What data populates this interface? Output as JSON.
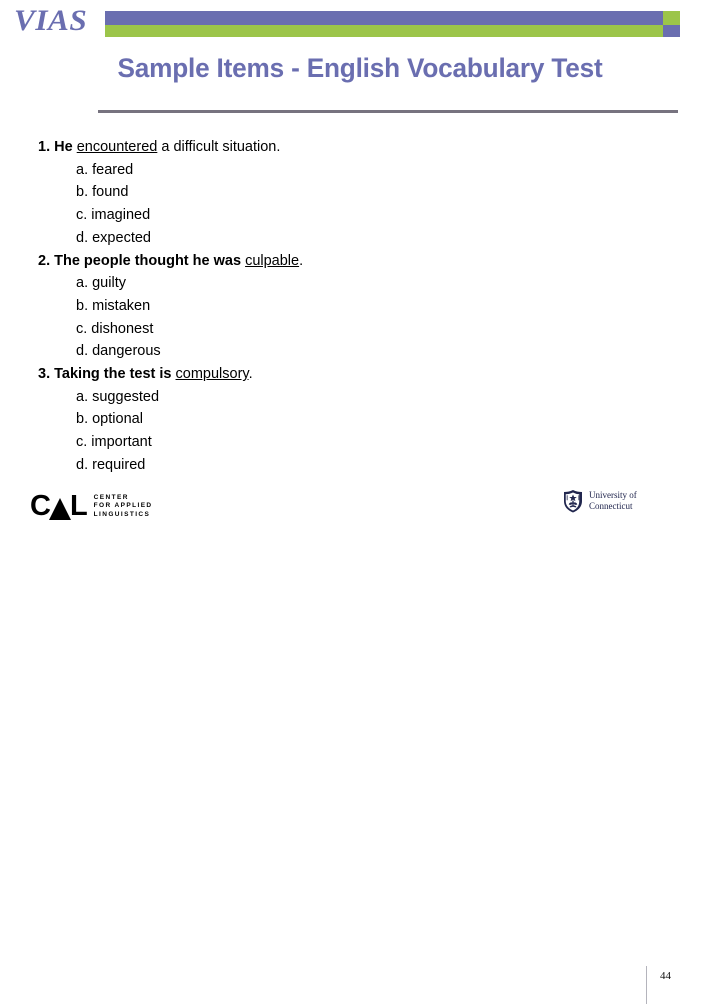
{
  "header": {
    "wordmark": "VIAS",
    "colors": {
      "purple": "#6a6eb0",
      "green": "#9cc54a",
      "divider": "#77737f"
    }
  },
  "title": "Sample Items - English Vocabulary Test",
  "items": [
    {
      "number": "1.",
      "stem_lead": "He",
      "stem_target": "encountered",
      "stem_tail": "a difficult situation.",
      "options": [
        "a. feared",
        "b. found",
        "c. imagined",
        "d. expected"
      ]
    },
    {
      "number": "2.",
      "stem_lead": "The people thought he was",
      "stem_target": "culpable",
      "stem_tail": ".",
      "options": [
        "a. guilty",
        "b. mistaken",
        "c. dishonest",
        "d. dangerous"
      ]
    },
    {
      "number": "3.",
      "stem_lead": "Taking the test is",
      "stem_target": "compulsory",
      "stem_tail": ".",
      "options": [
        "a. suggested",
        "b. optional",
        "c. important",
        "d. required"
      ]
    }
  ],
  "footer": {
    "cal": {
      "mark_c": "C",
      "mark_l": "L",
      "tagline_line1": "CENTER",
      "tagline_line2": "FOR APPLIED",
      "tagline_line3": "LINGUISTICS"
    },
    "uconn": {
      "line1": "University of",
      "line2": "Connecticut",
      "seal_color": "#21264e"
    },
    "page_number": "44"
  }
}
